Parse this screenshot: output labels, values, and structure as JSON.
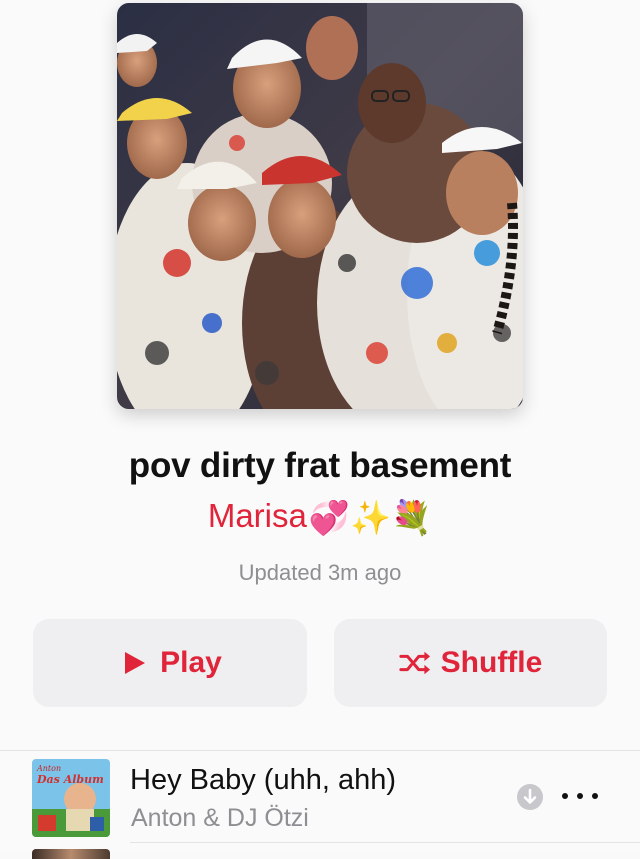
{
  "playlist": {
    "title": "pov dirty frat basement",
    "curator": "Marisa",
    "curator_emojis": "💞✨💐",
    "updated": "Updated 3m ago"
  },
  "actions": {
    "play_label": "Play",
    "shuffle_label": "Shuffle"
  },
  "tracks": [
    {
      "title": "Hey Baby (uhh, ahh)",
      "artist": "Anton & DJ Ötzi",
      "art_text_top": "Anton",
      "art_text_main": "Das Album"
    }
  ],
  "colors": {
    "accent": "#e0243a",
    "secondary_text": "#8e8e93",
    "button_bg": "#efeff1",
    "background": "#fafafa"
  },
  "icons": {
    "play": "play-triangle-icon",
    "shuffle": "shuffle-icon",
    "download": "download-arrow-icon",
    "more": "ellipsis-icon"
  }
}
